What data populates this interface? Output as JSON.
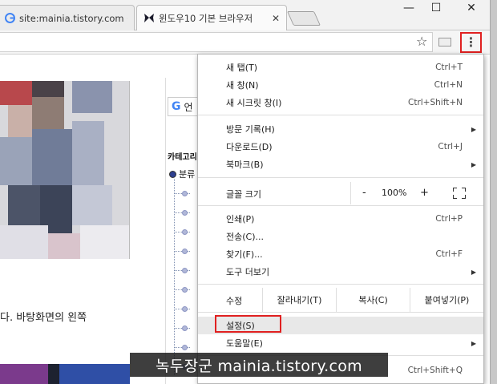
{
  "tabs": [
    {
      "title": "site:mainia.tistory.com 윈",
      "active": false
    },
    {
      "title": "윈도우10 기본 브라우저",
      "active": true
    }
  ],
  "window_controls": {
    "minimize": "—",
    "maximize": "☐",
    "close": "✕"
  },
  "toolbar": {
    "star_icon": "star-icon",
    "menu_icon": "three-dot-menu-icon"
  },
  "page": {
    "body_text": "다. 바탕화면의 왼쪽",
    "search_label": "언",
    "category_title": "카테고리",
    "category_root": "분류"
  },
  "menu": {
    "new_tab": {
      "label": "새 탭(T)",
      "shortcut": "Ctrl+T"
    },
    "new_window": {
      "label": "새 창(N)",
      "shortcut": "Ctrl+N"
    },
    "incognito": {
      "label": "새 시크릿 창(I)",
      "shortcut": "Ctrl+Shift+N"
    },
    "history": {
      "label": "방문 기록(H)"
    },
    "downloads": {
      "label": "다운로드(D)",
      "shortcut": "Ctrl+J"
    },
    "bookmarks": {
      "label": "북마크(B)"
    },
    "zoom": {
      "label": "글꼴 크기",
      "minus": "-",
      "value": "100%",
      "plus": "+"
    },
    "print": {
      "label": "인쇄(P)",
      "shortcut": "Ctrl+P"
    },
    "cast": {
      "label": "전송(C)..."
    },
    "find": {
      "label": "찾기(F)...",
      "shortcut": "Ctrl+F"
    },
    "more_tools": {
      "label": "도구 더보기"
    },
    "edit": {
      "label": "수정",
      "cut": "잘라내기(T)",
      "copy": "복사(C)",
      "paste": "붙여넣기(P)"
    },
    "settings": {
      "label": "설정(S)"
    },
    "help": {
      "label": "도움말(E)"
    },
    "exit": {
      "shortcut": "Ctrl+Shift+Q"
    }
  },
  "watermark": "녹두장군 mainia.tistory.com",
  "colors": {
    "highlight_red": "#e02020",
    "menu_hover": "#e8e8e8"
  }
}
